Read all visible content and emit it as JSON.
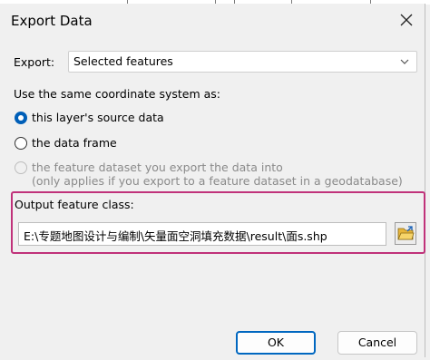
{
  "dialog": {
    "title": "Export Data",
    "export_label": "Export:",
    "export_value": "Selected features",
    "coord_prompt": "Use the same coordinate system as:",
    "options": [
      {
        "label": "this layer's source data",
        "checked": true,
        "enabled": true
      },
      {
        "label": "the data frame",
        "checked": false,
        "enabled": true
      },
      {
        "label": "the feature dataset you export the data into",
        "note": "(only applies if you export to a feature dataset in a geodatabase)",
        "checked": false,
        "enabled": false
      }
    ],
    "output_label": "Output feature class:",
    "output_path": "E:\\专题地图设计与编制\\矢量面空洞填充数据\\result\\面s.shp",
    "ok_label": "OK",
    "cancel_label": "Cancel"
  },
  "icons": {
    "close": "close-icon",
    "dropdown": "chevron-down-icon",
    "browse": "folder-open-icon"
  },
  "colors": {
    "highlight": "#c0327a",
    "accent": "#0067c0"
  }
}
